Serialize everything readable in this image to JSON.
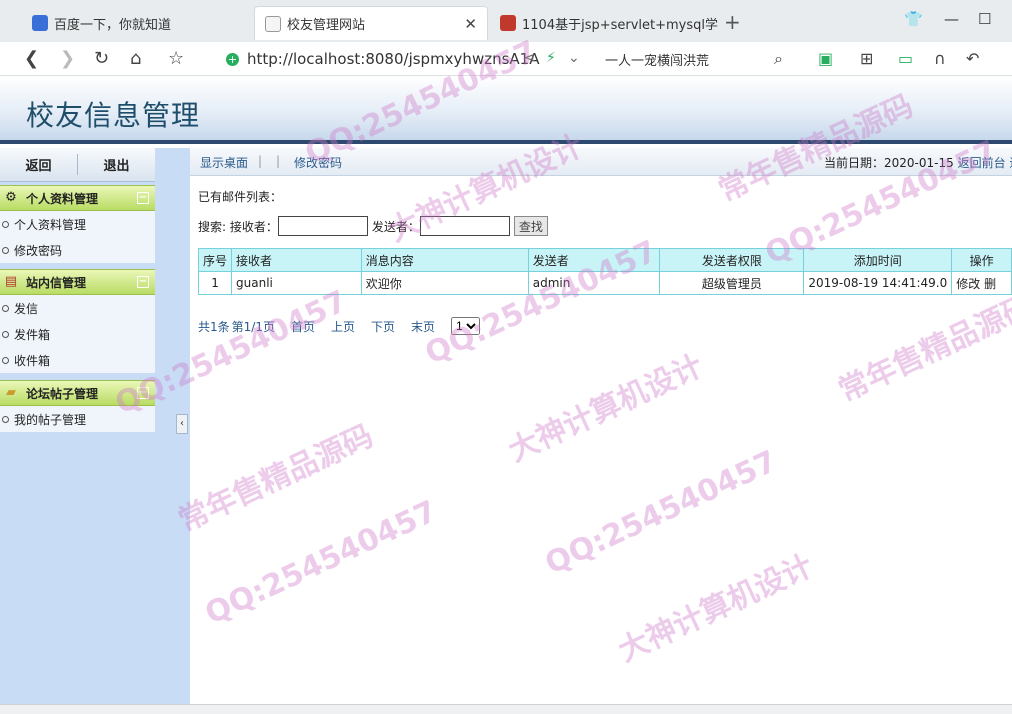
{
  "browser": {
    "tabs": [
      {
        "title": "百度一下，你就知道",
        "active": false
      },
      {
        "title": "校友管理网站",
        "active": true
      },
      {
        "title": "1104基于jsp+servlet+mysql学",
        "active": false
      }
    ],
    "url": "http://localhost:8080/jspmxyhwznsA1A",
    "search_text": "一人一宠横闯洪荒"
  },
  "header": {
    "title": "校友信息管理"
  },
  "sidebar": {
    "back_label": "返回",
    "logout_label": "退出",
    "sections": [
      {
        "title": "个人资料管理",
        "icon": "gear-icon",
        "items": [
          {
            "label": "个人资料管理"
          },
          {
            "label": "修改密码"
          }
        ]
      },
      {
        "title": "站内信管理",
        "icon": "calendar-icon",
        "items": [
          {
            "label": "发信"
          },
          {
            "label": "发件箱"
          },
          {
            "label": "收件箱"
          }
        ]
      },
      {
        "title": "论坛帖子管理",
        "icon": "folder-icon",
        "items": [
          {
            "label": "我的帖子管理"
          }
        ]
      }
    ]
  },
  "topnav": {
    "show_desktop": "显示桌面",
    "change_password": "修改密码",
    "date_label": "当前日期：2020-01-15",
    "back_front": "返回前台",
    "exit_short": "退"
  },
  "main": {
    "list_title": "已有邮件列表：",
    "search": {
      "prefix": "搜索: 接收者：",
      "sender_label": "发送者：",
      "button": "查找"
    },
    "table": {
      "headers": [
        "序号",
        "接收者",
        "消息内容",
        "发送者",
        "发送者权限",
        "添加时间",
        "操作"
      ],
      "rows": [
        {
          "no": "1",
          "receiver": "guanli",
          "content": "欢迎你",
          "sender": "admin",
          "role": "超级管理员",
          "time": "2019-08-19 14:41:49.0",
          "edit": "修改",
          "del": "删"
        }
      ]
    },
    "pager": {
      "total": "共1条",
      "page": "第1/1页",
      "first": "首页",
      "prev": "上页",
      "next": "下页",
      "last": "末页",
      "select_value": "1"
    }
  },
  "watermarks": [
    "QQ:254540457",
    "常年售精品源码",
    "大神计算机设计"
  ]
}
